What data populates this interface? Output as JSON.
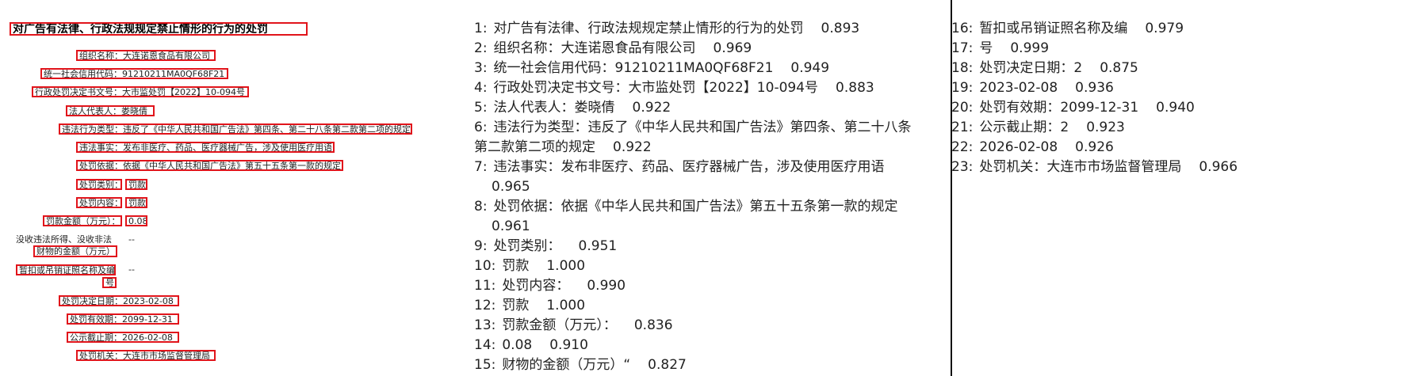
{
  "document": {
    "title": "对广告有法律、行政法规规定禁止情形的行为的处罚",
    "fields": {
      "org_name": "组织名称：大连诺恩食品有限公司",
      "credit_code": "统一社会信用代码：91210211MA0QF68F21",
      "decision_no": "行政处罚决定书文号：大市监处罚【2022】10-094号",
      "legal_rep": "法人代表人：娄晓倩",
      "violation_type": "违法行为类型：违反了《中华人民共和国广告法》第四条、第二十八条第二款第二项的规定",
      "violation_fact": "违法事实：发布非医疗、药品、医疗器械广告，涉及使用医疗用语",
      "basis": "处罚依据：依据《中华人民共和国广告法》第五十五条第一款的规定",
      "penalty_category_label": "处罚类别：",
      "penalty_category_value": "罚款",
      "penalty_content_label": "处罚内容：",
      "penalty_content_value": "罚款",
      "fine_label": "罚款金额（万元）：",
      "fine_value": "0.08",
      "confiscation_line1": "没收违法所得、没收非法",
      "confiscation_dash": "--",
      "confiscation_line2": "财物的金额（万元）",
      "revoke_line1": "暂扣或吊销证照名称及编",
      "revoke_dash": "--",
      "revoke_line2": "号",
      "decision_date": "处罚决定日期：2023-02-08",
      "valid_until": "处罚有效期：2099-12-31",
      "publish_until": "公示截止期：2026-02-08",
      "authority": "处罚机关：大连市市场监督管理局"
    }
  },
  "ocr_results": [
    {
      "n": "1:",
      "text": "对广告有法律、行政法规规定禁止情形的行为的处罚",
      "score": "0.893"
    },
    {
      "n": "2:",
      "text": "组织名称：大连诺恩食品有限公司",
      "score": "0.969"
    },
    {
      "n": "3:",
      "text": "统一社会信用代码：91210211MA0QF68F21",
      "score": "0.949"
    },
    {
      "n": "4:",
      "text": "行政处罚决定书文号：大市监处罚【2022】10-094号",
      "score": "0.883"
    },
    {
      "n": "5:",
      "text": "法人代表人：娄晓倩",
      "score": "0.922"
    },
    {
      "n": "6:",
      "text": "违法行为类型：违反了《中华人民共和国广告法》第四条、第二十八条第二款第二项的规定",
      "score": "0.922"
    },
    {
      "n": "7:",
      "text": "违法事实：发布非医疗、药品、医疗器械广告，涉及使用医疗用语",
      "score": "0.965"
    },
    {
      "n": "8:",
      "text": "处罚依据：依据《中华人民共和国广告法》第五十五条第一款的规定",
      "score": "0.961"
    },
    {
      "n": "9:",
      "text": "处罚类别：",
      "score": "0.951"
    },
    {
      "n": "10:",
      "text": "罚款",
      "score": "1.000"
    },
    {
      "n": "11:",
      "text": "处罚内容：",
      "score": "0.990"
    },
    {
      "n": "12:",
      "text": "罚款",
      "score": "1.000"
    },
    {
      "n": "13:",
      "text": "罚款金额（万元）：",
      "score": "0.836"
    },
    {
      "n": "14:",
      "text": "0.08",
      "score": "0.910"
    },
    {
      "n": "15:",
      "text": "财物的金额（万元）“",
      "score": "0.827"
    },
    {
      "n": "16:",
      "text": "暂扣或吊销证照名称及编",
      "score": "0.979"
    },
    {
      "n": "17:",
      "text": "号",
      "score": "0.999"
    },
    {
      "n": "18:",
      "text": "处罚决定日期：2",
      "score": "0.875"
    },
    {
      "n": "19:",
      "text": "2023-02-08",
      "score": "0.936"
    },
    {
      "n": "20:",
      "text": "处罚有效期：2099-12-31",
      "score": "0.940"
    },
    {
      "n": "21:",
      "text": "公示截止期：2",
      "score": "0.923"
    },
    {
      "n": "22:",
      "text": "2026-02-08",
      "score": "0.926"
    },
    {
      "n": "23:",
      "text": "处罚机关：大连市市场监督管理局",
      "score": "0.966"
    }
  ]
}
